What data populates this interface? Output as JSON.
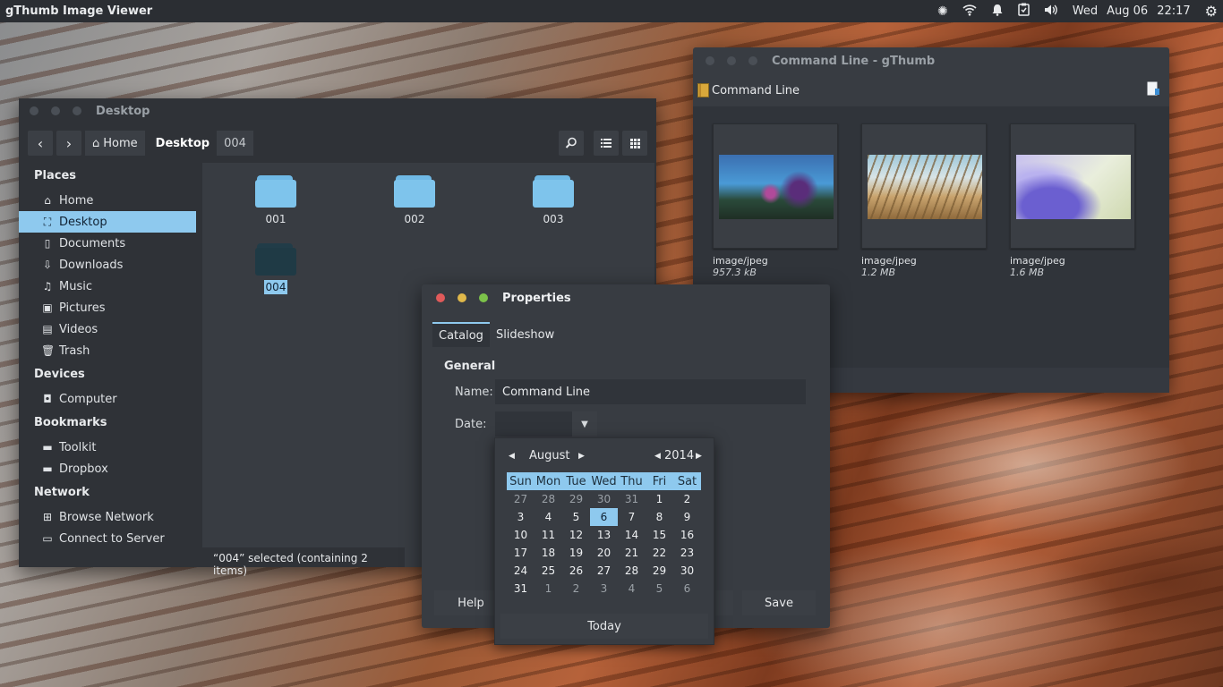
{
  "topbar": {
    "app_title": "gThumb Image Viewer",
    "day": "Wed",
    "date": "Aug 06",
    "time": "22:17"
  },
  "file_manager": {
    "title": "Desktop",
    "breadcrumbs": [
      "Home",
      "Desktop",
      "004"
    ],
    "sidebar": {
      "places_header": "Places",
      "places": [
        {
          "label": "Home",
          "icon": "home-icon"
        },
        {
          "label": "Desktop",
          "icon": "desktop-icon"
        },
        {
          "label": "Documents",
          "icon": "document-icon"
        },
        {
          "label": "Downloads",
          "icon": "download-icon"
        },
        {
          "label": "Music",
          "icon": "music-icon"
        },
        {
          "label": "Pictures",
          "icon": "pictures-icon"
        },
        {
          "label": "Videos",
          "icon": "videos-icon"
        },
        {
          "label": "Trash",
          "icon": "trash-icon"
        }
      ],
      "devices_header": "Devices",
      "devices": [
        {
          "label": "Computer",
          "icon": "drive-icon"
        }
      ],
      "bookmarks_header": "Bookmarks",
      "bookmarks": [
        {
          "label": "Toolkit",
          "icon": "folder-icon"
        },
        {
          "label": "Dropbox",
          "icon": "folder-icon"
        }
      ],
      "network_header": "Network",
      "network": [
        {
          "label": "Browse Network",
          "icon": "network-icon"
        },
        {
          "label": "Connect to Server",
          "icon": "server-icon"
        }
      ]
    },
    "folders": [
      "001",
      "002",
      "003",
      "004"
    ],
    "selected_folder": "004",
    "status": "“004” selected  (containing 2 items)",
    "accent": "#8ec9ee"
  },
  "gthumb": {
    "title": "Command Line - gThumb",
    "location": "Command Line",
    "thumbnails": [
      {
        "type": "image/jpeg",
        "size": "957.3 kB"
      },
      {
        "type": "image/jpeg",
        "size": "1.2 MB"
      },
      {
        "type": "image/jpeg",
        "size": "1.6 MB"
      }
    ]
  },
  "properties": {
    "title": "Properties",
    "tabs": [
      "Catalog",
      "Slideshow"
    ],
    "section": "General",
    "name_label": "Name:",
    "name_value": "Command Line",
    "date_label": "Date:",
    "help_label": "Help",
    "save_label": "Save"
  },
  "calendar": {
    "month": "August",
    "year": "2014",
    "weekdays": [
      "Sun",
      "Mon",
      "Tue",
      "Wed",
      "Thu",
      "Fri",
      "Sat"
    ],
    "selected_day": "6",
    "today_label": "Today",
    "weeks": [
      [
        "27",
        "28",
        "29",
        "30",
        "31",
        "1",
        "2"
      ],
      [
        "3",
        "4",
        "5",
        "6",
        "7",
        "8",
        "9"
      ],
      [
        "10",
        "11",
        "12",
        "13",
        "14",
        "15",
        "16"
      ],
      [
        "17",
        "18",
        "19",
        "20",
        "21",
        "22",
        "23"
      ],
      [
        "24",
        "25",
        "26",
        "27",
        "28",
        "29",
        "30"
      ],
      [
        "31",
        "1",
        "2",
        "3",
        "4",
        "5",
        "6"
      ]
    ]
  }
}
